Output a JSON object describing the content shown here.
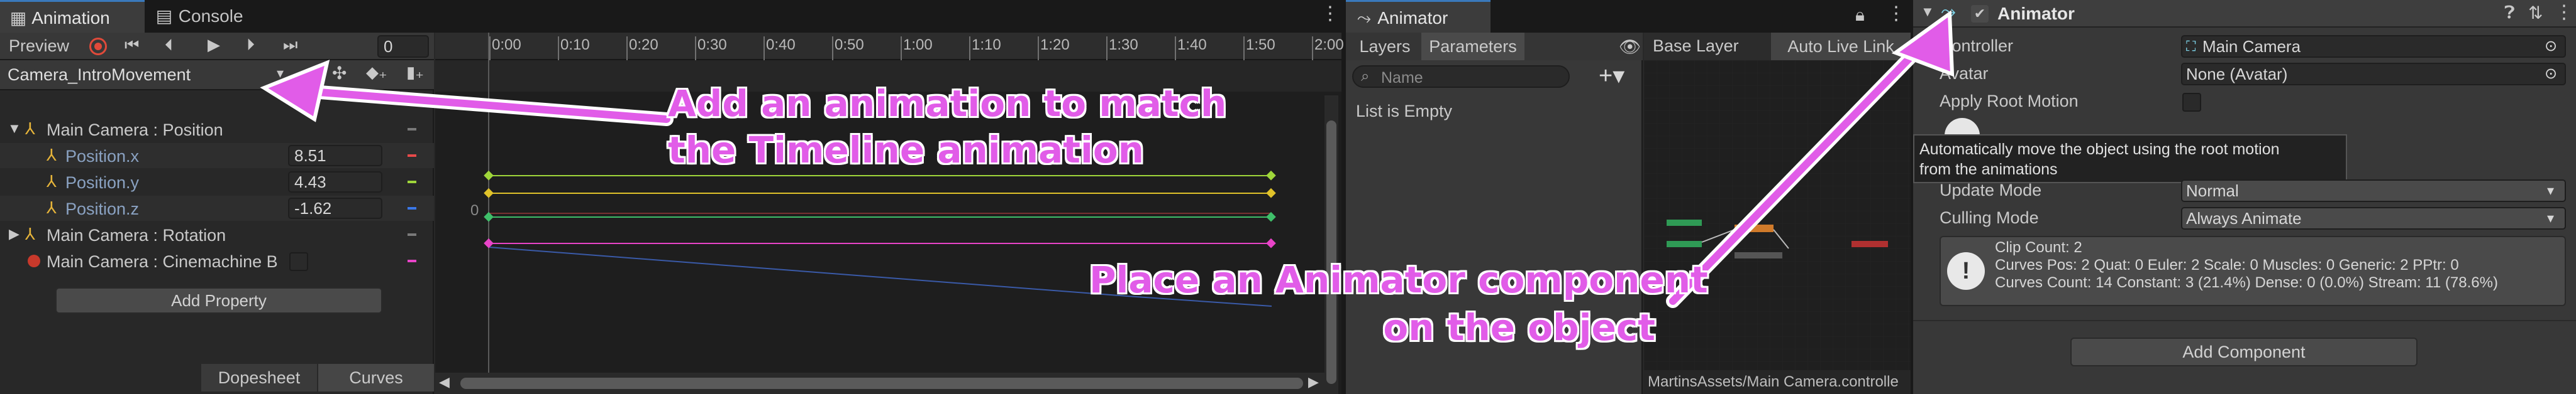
{
  "animation": {
    "tabs": [
      {
        "label": "Animation"
      },
      {
        "label": "Console"
      }
    ],
    "preview_label": "Preview",
    "frame_value": "0",
    "clip_name": "Camera_IntroMovement",
    "timeline_ticks": [
      "0:00",
      "0:10",
      "0:20",
      "0:30",
      "0:40",
      "0:50",
      "1:00",
      "1:10",
      "1:20",
      "1:30",
      "1:40",
      "1:50",
      "2:00"
    ],
    "properties": [
      {
        "label": "Main Camera : Position",
        "kind": "group"
      },
      {
        "label": "Position.x",
        "value": "8.51",
        "color": "#e84a4a"
      },
      {
        "label": "Position.y",
        "value": "4.43",
        "color": "#9fd63a"
      },
      {
        "label": "Position.z",
        "value": "-1.62",
        "color": "#3a78e8"
      },
      {
        "label": "Main Camera : Rotation",
        "kind": "group"
      },
      {
        "label": "Main Camera : Cinemachine B",
        "kind": "toggle"
      }
    ],
    "curve_zero_label": "0",
    "add_property": "Add Property",
    "bottom_tabs": [
      {
        "label": "Dopesheet"
      },
      {
        "label": "Curves"
      }
    ]
  },
  "animator": {
    "title": "Animator",
    "tabs": [
      {
        "label": "Layers"
      },
      {
        "label": "Parameters"
      }
    ],
    "search_placeholder": "Name",
    "empty_text": "List is Empty",
    "layer_label": "Base Layer",
    "auto_live_label": "Auto Live Link",
    "footer_path": "MartinsAssets/Main Camera.controlle"
  },
  "inspector": {
    "component_title": "Animator",
    "rows": [
      {
        "label": "Controller",
        "value": "Main Camera"
      },
      {
        "label": "Avatar",
        "value": "None (Avatar)"
      },
      {
        "label": "Apply Root Motion",
        "value": ""
      },
      {
        "label": "Update Mode",
        "value": "Normal"
      },
      {
        "label": "Culling Mode",
        "value": "Always Animate"
      }
    ],
    "tooltip": [
      "Automatically move the object using the root motion",
      "from the animations"
    ],
    "info_lines": [
      "Clip Count: 2",
      "Curves Pos: 2 Quat: 0 Euler: 2 Scale: 0 Muscles: 0 Generic: 2 PPtr: 0",
      "Curves Count: 14 Constant: 3 (21.4%) Dense: 0 (0.0%) Stream: 11 (78.6%)"
    ],
    "add_component": "Add Component"
  },
  "annotations": {
    "top": [
      "Add an animation to match",
      "the Timeline animation"
    ],
    "bottom": [
      "Place an Animator component",
      "on the object"
    ]
  },
  "colors": {
    "annotation": "#e15ce8",
    "accent_blue": "#3a79bb",
    "record_red": "#e04a3a"
  }
}
